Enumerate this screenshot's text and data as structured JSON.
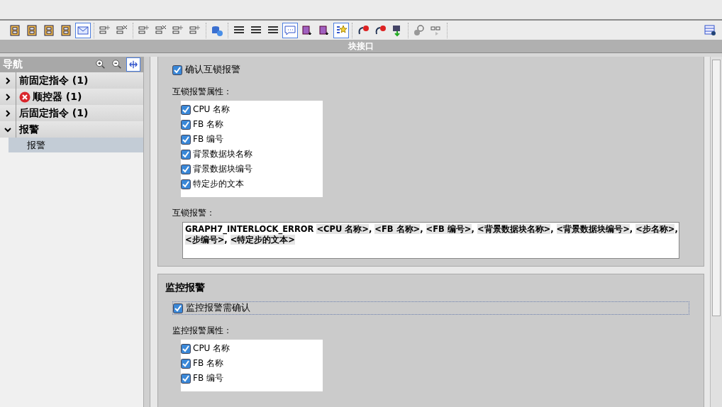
{
  "toolbar": {
    "groups": [
      [
        {
          "kind": "block",
          "selected": false
        },
        {
          "kind": "block",
          "selected": false
        },
        {
          "kind": "block",
          "selected": false
        },
        {
          "kind": "block",
          "selected": false
        },
        {
          "kind": "mail",
          "selected": true
        }
      ],
      [
        {
          "kind": "list-add",
          "selected": false
        },
        {
          "kind": "list-remove",
          "selected": false
        }
      ],
      [
        {
          "kind": "list-add",
          "selected": false
        },
        {
          "kind": "list-remove",
          "selected": false
        },
        {
          "kind": "list-add",
          "selected": false
        },
        {
          "kind": "list-add",
          "selected": false
        }
      ],
      [
        {
          "kind": "database",
          "selected": false
        }
      ],
      [
        {
          "kind": "lines",
          "selected": false
        },
        {
          "kind": "lines",
          "selected": false
        },
        {
          "kind": "lines",
          "selected": false
        },
        {
          "kind": "chat",
          "selected": true
        },
        {
          "kind": "tag",
          "selected": false
        },
        {
          "kind": "tag",
          "selected": false
        },
        {
          "kind": "star",
          "selected": true
        }
      ],
      [
        {
          "kind": "error-arrow",
          "selected": false
        },
        {
          "kind": "error-arrow",
          "selected": false
        },
        {
          "kind": "check",
          "selected": false
        }
      ],
      [
        {
          "kind": "search",
          "selected": false
        },
        {
          "kind": "glasses",
          "selected": false
        }
      ]
    ]
  },
  "panel_title": "块接口",
  "navigation": {
    "title": "导航",
    "buttons": [
      {
        "kind": "zoom-in",
        "selected": false
      },
      {
        "kind": "zoom-out",
        "selected": false
      },
      {
        "kind": "fit",
        "selected": true
      }
    ],
    "items": [
      {
        "label": "前固定指令 (1)",
        "expanded": false,
        "error": false
      },
      {
        "label": "顺控器 (1)",
        "expanded": false,
        "error": true
      },
      {
        "label": "后固定指令 (1)",
        "expanded": false,
        "error": false
      },
      {
        "label": "报警",
        "expanded": true,
        "error": false,
        "children": [
          {
            "label": "报警",
            "selected": true
          }
        ]
      }
    ]
  },
  "sections": [
    {
      "acknowledge": {
        "label": "确认互锁报警",
        "checked": true,
        "focused": false
      },
      "attributes_label": "互锁报警属性：",
      "attributes": [
        {
          "label": "CPU 名称",
          "checked": true
        },
        {
          "label": "FB 名称",
          "checked": true
        },
        {
          "label": "FB 编号",
          "checked": true
        },
        {
          "label": "背景数据块名称",
          "checked": true
        },
        {
          "label": "背景数据块编号",
          "checked": true
        },
        {
          "label": "特定步的文本",
          "checked": true
        }
      ],
      "message_label": "互锁报警：",
      "message_lines": [
        [
          {
            "kind": "plain",
            "text": "GRAPH7_INTERLOCK_ERROR "
          },
          {
            "kind": "field",
            "text": "<CPU 名称>"
          },
          {
            "kind": "plain",
            "text": ", "
          },
          {
            "kind": "field",
            "text": "<FB 名称>"
          },
          {
            "kind": "plain",
            "text": ", "
          },
          {
            "kind": "field",
            "text": "<FB 编号>"
          },
          {
            "kind": "plain",
            "text": ", "
          },
          {
            "kind": "field",
            "text": "<背景数据块名称>"
          },
          {
            "kind": "plain",
            "text": ", "
          },
          {
            "kind": "field",
            "text": "<背景数据块编号>"
          },
          {
            "kind": "plain",
            "text": ", "
          },
          {
            "kind": "field",
            "text": "<步名称>"
          },
          {
            "kind": "plain",
            "text": ","
          }
        ],
        [
          {
            "kind": "field",
            "text": "<步编号>"
          },
          {
            "kind": "plain",
            "text": ", "
          },
          {
            "kind": "field",
            "text": "<特定步的文本>"
          }
        ]
      ]
    },
    {
      "heading": "监控报警",
      "acknowledge": {
        "label": "监控报警需确认",
        "checked": true,
        "focused": true
      },
      "attributes_label": "监控报警属性：",
      "attributes": [
        {
          "label": "CPU 名称",
          "checked": true
        },
        {
          "label": "FB 名称",
          "checked": true
        },
        {
          "label": "FB 编号",
          "checked": true
        }
      ]
    }
  ]
}
